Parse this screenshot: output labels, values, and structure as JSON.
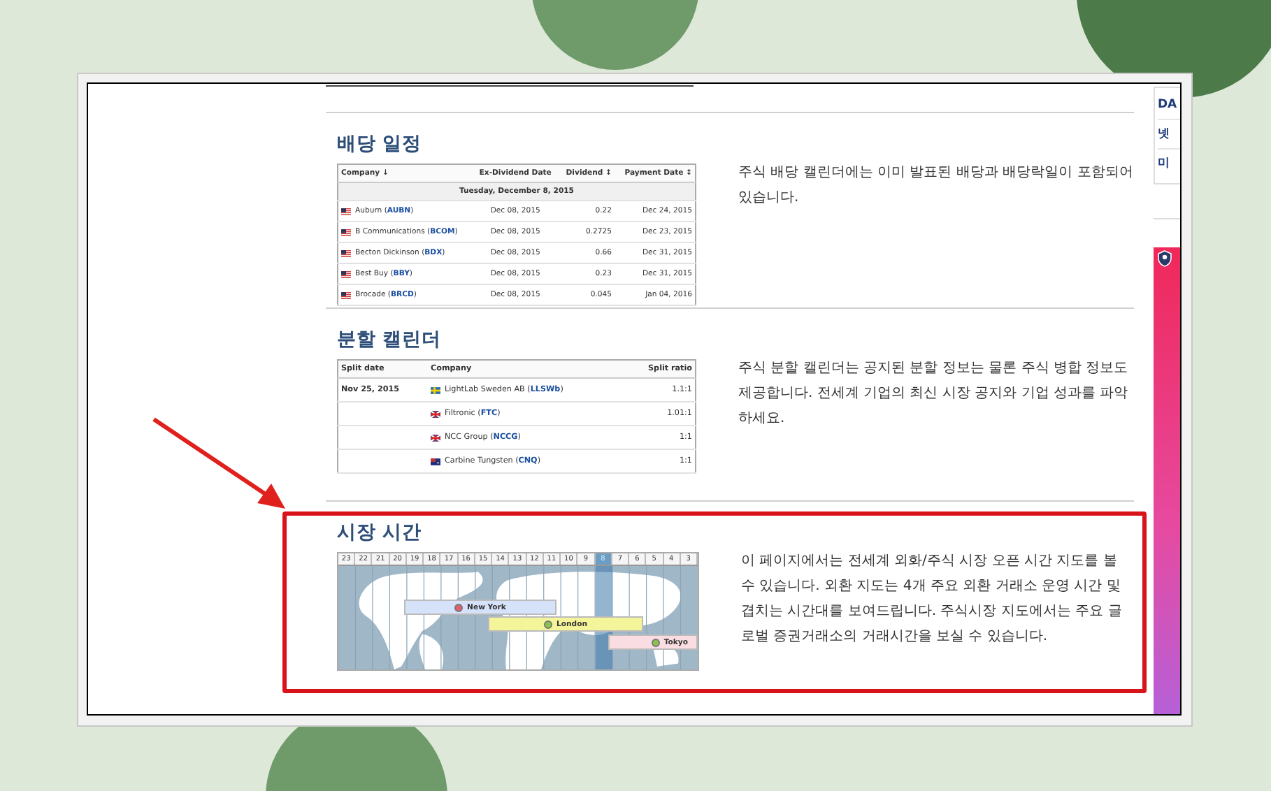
{
  "sections": [
    {
      "kind": "dividends",
      "title": "배당 일정",
      "table": {
        "columns": [
          "Company ↓",
          "Ex-Dividend Date",
          "Dividend ↕",
          "Payment Date ↕"
        ],
        "group": "Tuesday, December 8, 2015",
        "rows": [
          {
            "kind": "us",
            "company": "Auburn (**AUBN**)",
            "ex_date": "Dec 08, 2015",
            "dividend": "0.22",
            "pay_date": "Dec 24, 2015"
          },
          {
            "kind": "us",
            "company": "B Communications (**BCOM**)",
            "ex_date": "Dec 08, 2015",
            "dividend": "0.2725",
            "pay_date": "Dec 23, 2015"
          },
          {
            "kind": "us",
            "company": "Becton Dickinson (**BDX**)",
            "ex_date": "Dec 08, 2015",
            "dividend": "0.66",
            "pay_date": "Dec 31, 2015"
          },
          {
            "kind": "us",
            "company": "Best Buy (**BBY**)",
            "ex_date": "Dec 08, 2015",
            "dividend": "0.23",
            "pay_date": "Dec 31, 2015"
          },
          {
            "kind": "us",
            "company": "Brocade (**BRCD**)",
            "ex_date": "Dec 08, 2015",
            "dividend": "0.045",
            "pay_date": "Jan 04, 2016"
          }
        ]
      },
      "description": "주식 배당 캘린더에는 이미 발표된 배당과 배당락일이 포함되어 있습니다."
    },
    {
      "kind": "splits",
      "title": "분할 캘린더",
      "table": {
        "columns": [
          "Split date",
          "Company",
          "Split ratio"
        ],
        "rows": [
          {
            "date": "Nov 25, 2015",
            "kind": "se",
            "company": "LightLab Sweden AB (**LLSWb**)",
            "ratio": "1.1:1"
          },
          {
            "kind": "gb",
            "company": "Filtronic (**FTC**)",
            "ratio": "1.01:1"
          },
          {
            "kind": "gb",
            "company": "NCC Group (**NCCG**)",
            "ratio": "1:1"
          },
          {
            "kind": "au",
            "company": "Carbine Tungsten (**CNQ**)",
            "ratio": "1:1"
          }
        ]
      },
      "description": "주식 분할 캘린더는 공지된 분할 정보는 물론 주식 병합 정보도 제공합니다. 전세계 기업의 최신 시장 공지와 기업 성과를 파악하세요."
    },
    {
      "kind": "hours",
      "title": "시장 시간",
      "highlighted": true,
      "map": {
        "hours": [
          {
            "label": "23",
            "current": false
          },
          {
            "label": "22",
            "current": false
          },
          {
            "label": "21",
            "current": false
          },
          {
            "label": "20",
            "current": false
          },
          {
            "label": "19",
            "current": false
          },
          {
            "label": "18",
            "current": false
          },
          {
            "label": "17",
            "current": false
          },
          {
            "label": "16",
            "current": false
          },
          {
            "label": "15",
            "current": false
          },
          {
            "label": "14",
            "current": false
          },
          {
            "label": "13",
            "current": false
          },
          {
            "label": "12",
            "current": false
          },
          {
            "label": "11",
            "current": false
          },
          {
            "label": "10",
            "current": false
          },
          {
            "label": "9",
            "current": false
          },
          {
            "label": "8",
            "current": true
          },
          {
            "label": "7",
            "current": false
          },
          {
            "label": "6",
            "current": false
          },
          {
            "label": "5",
            "current": false
          },
          {
            "label": "4",
            "current": false
          },
          {
            "label": "3",
            "current": false
          }
        ],
        "markets": [
          {
            "name": "New York",
            "color": "#d6e2fa",
            "open": false
          },
          {
            "name": "London",
            "color": "#f4f49a",
            "open": true
          },
          {
            "name": "Tokyo",
            "color": "#fadde2",
            "open": true
          }
        ]
      },
      "description": "이 페이지에서는 전세계 외화/주식 시장 오픈 시간 지도를 볼 수 있습니다. 외환 지도는 4개 주요 외환 거래소 운영 시간 및 겹치는 시간대를 보여드립니다. 주식시장 지도에서는 주요 글로벌 증권거래소의 거래시간을 보실 수 있습니다."
    }
  ],
  "sidebar": {
    "items": [
      "DA",
      "넷",
      "미"
    ]
  }
}
